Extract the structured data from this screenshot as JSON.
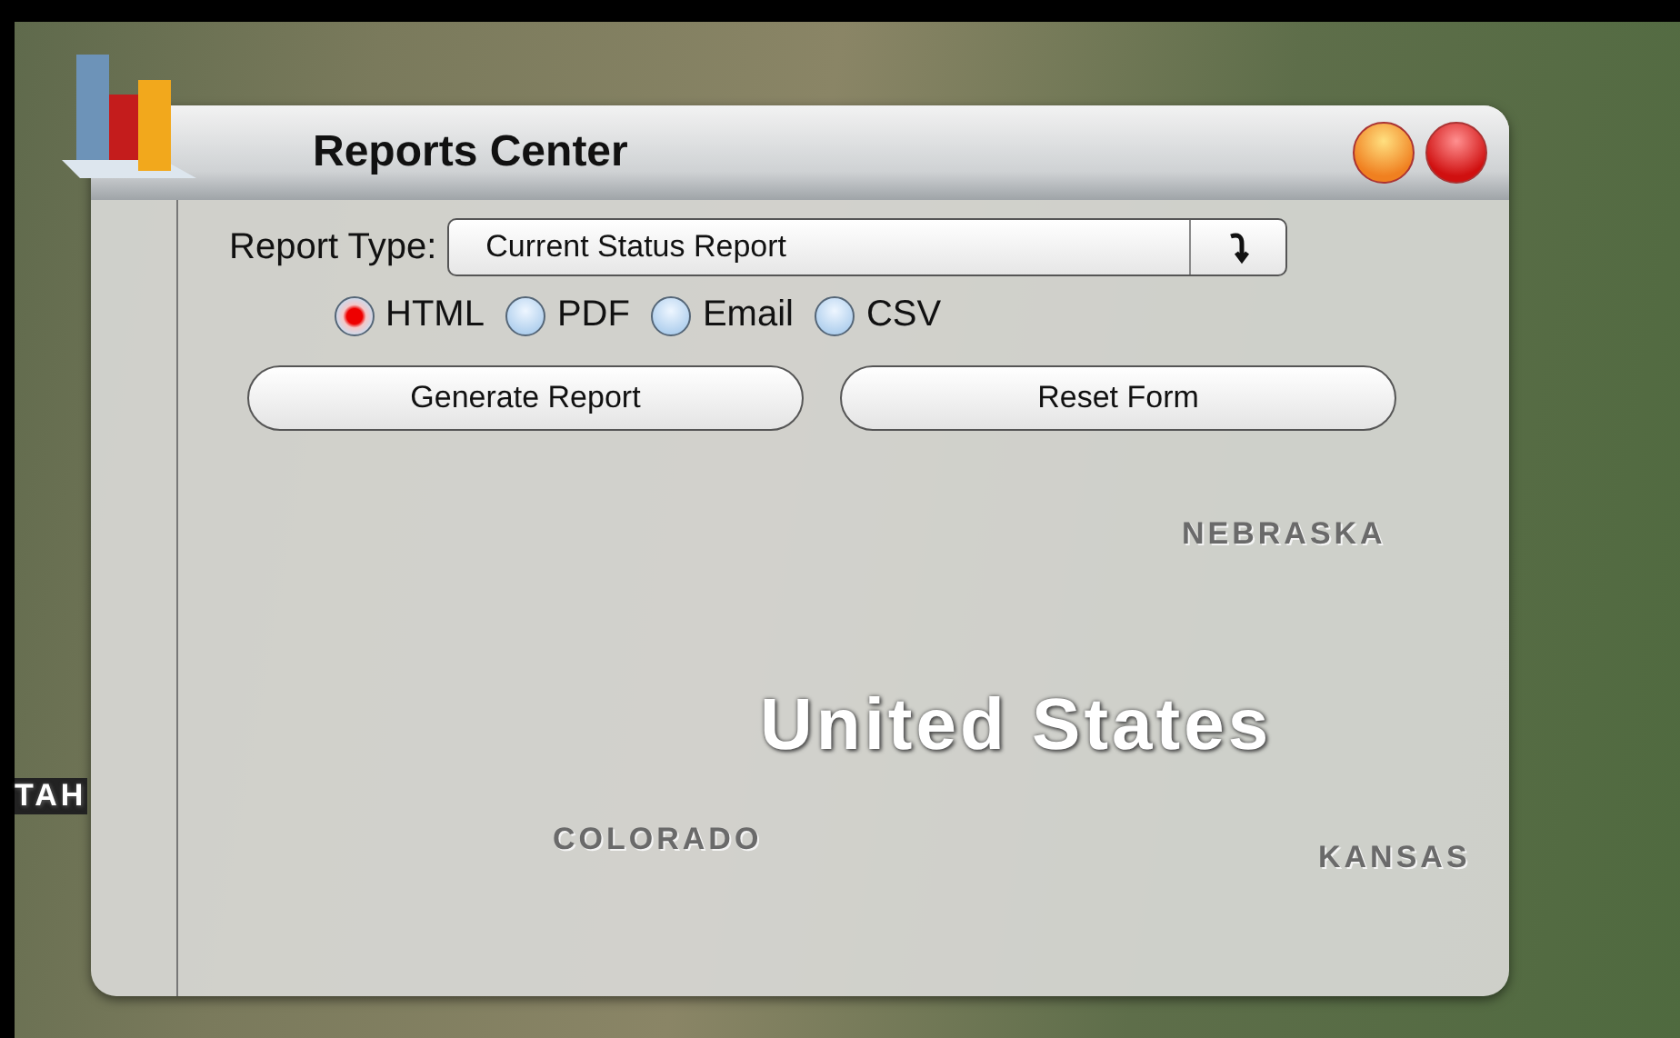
{
  "window": {
    "title": "Reports Center"
  },
  "report_type": {
    "label": "Report Type:",
    "value": "Current Status Report"
  },
  "formats": [
    {
      "label": "HTML",
      "selected": true
    },
    {
      "label": "PDF",
      "selected": false
    },
    {
      "label": "Email",
      "selected": false
    },
    {
      "label": "CSV",
      "selected": false
    }
  ],
  "buttons": [
    "Generate Report",
    "Reset Form"
  ],
  "map_labels": [
    {
      "text": "NEBRASKA",
      "kind": "state"
    },
    {
      "text": "United States",
      "kind": "country"
    },
    {
      "text": "TAH",
      "kind": "edge"
    },
    {
      "text": "COLORADO",
      "kind": "state"
    },
    {
      "text": "KANSAS",
      "kind": "state"
    }
  ]
}
